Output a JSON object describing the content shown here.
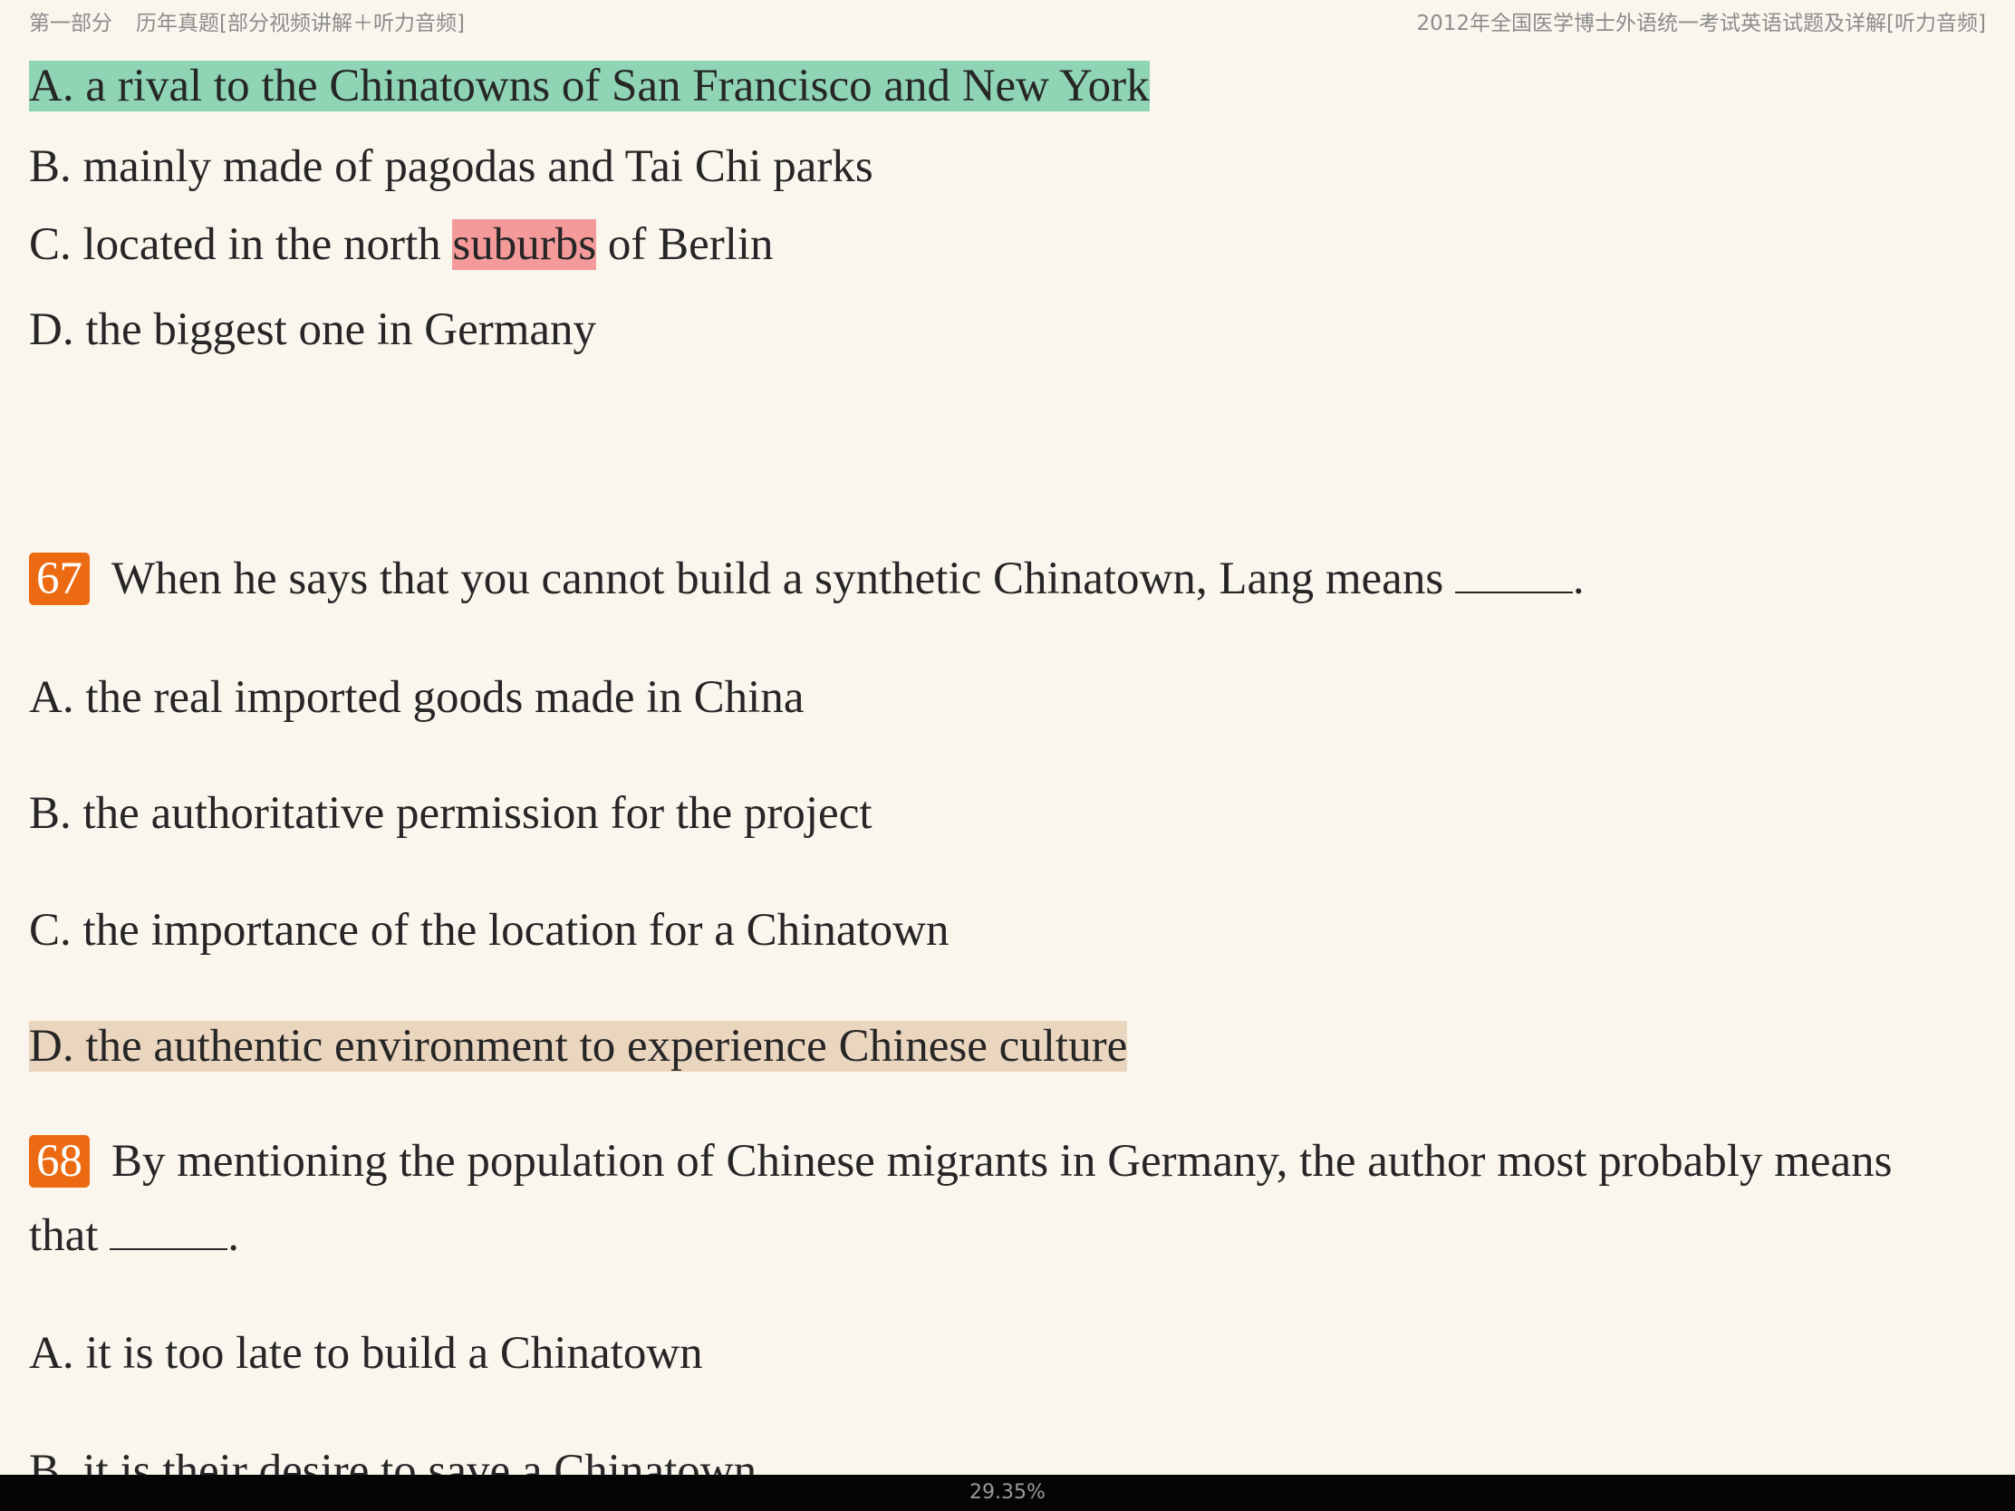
{
  "header": {
    "section_label": "第一部分",
    "chapter_title": "历年真题[部分视频讲解＋听力音频]",
    "book_title": "2012年全国医学博士外语统一考试英语试题及详解[听力音频]"
  },
  "q66_options": {
    "a": "A. a rival to the Chinatowns of San Francisco and New York",
    "b": "B. mainly made of pagodas and Tai Chi parks",
    "c_before": "C. located in the north ",
    "c_highlight": "suburbs",
    "c_after": " of Berlin",
    "d": "D. the biggest one in Germany"
  },
  "q67": {
    "number": "67",
    "stem": "When he says that you cannot build a synthetic Chinatown, Lang means ",
    "end": ".",
    "a": "A. the real imported goods made in China",
    "b": "B. the authoritative permission for the project",
    "c": "C. the importance of the location for a Chinatown",
    "d": "D. the authentic environment to experience Chinese culture"
  },
  "q68": {
    "number": "68",
    "stem_line1": "By mentioning the population of Chinese migrants in Germany, the author most probably means",
    "stem_line2": "that ",
    "end": ".",
    "a": "A. it is too late to build a Chinatown",
    "b": "B. it is their desire to save a Chinatown"
  },
  "status": {
    "progress": "29.35%"
  },
  "colors": {
    "background": "#faf6ee",
    "highlight_green": "#8fd4b5",
    "highlight_red": "#f59a9a",
    "highlight_tan": "#ead5bf",
    "question_badge": "#ec6b12"
  }
}
